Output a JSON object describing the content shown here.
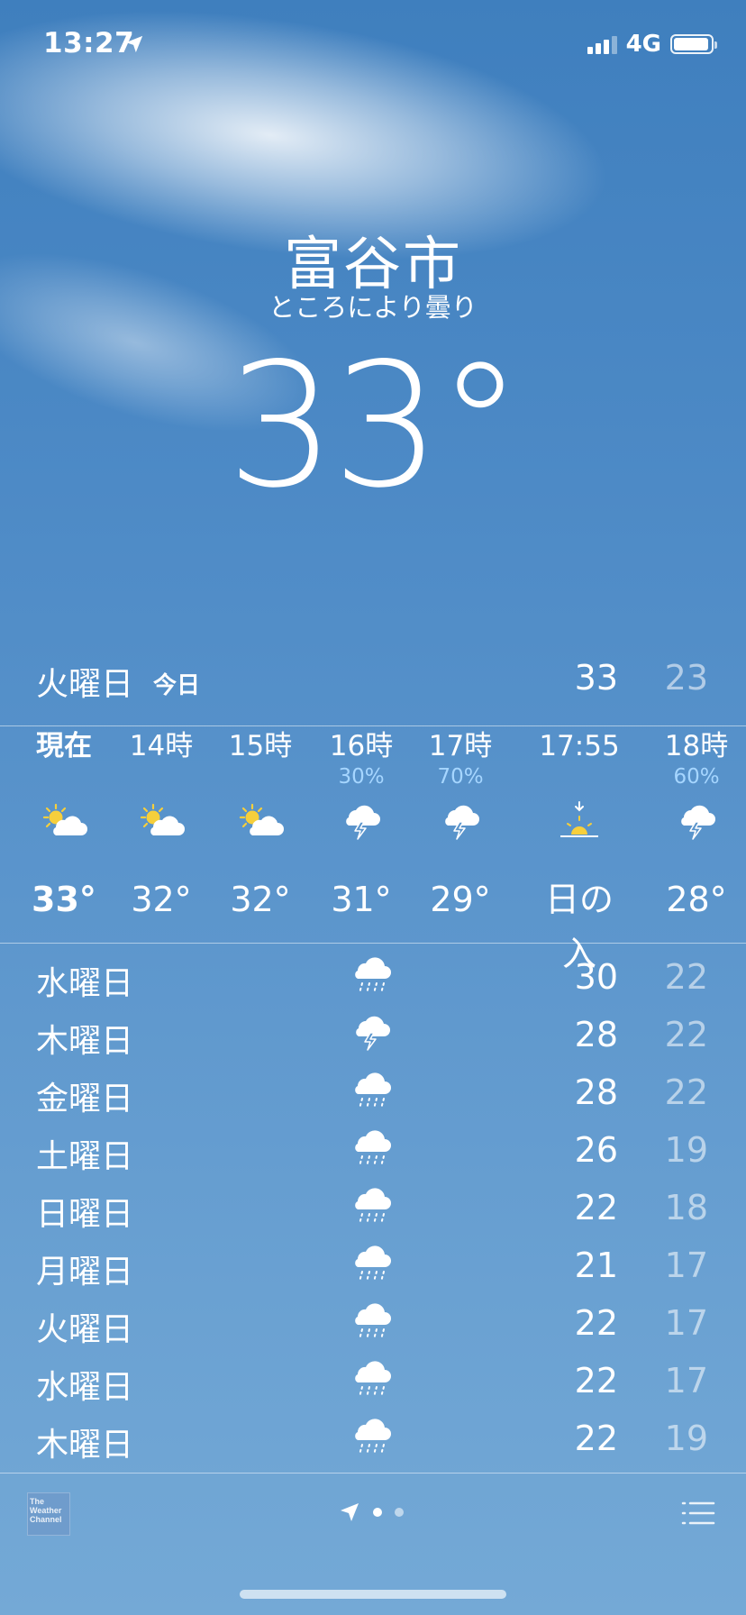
{
  "status_bar": {
    "time": "13:27",
    "network": "4G"
  },
  "location": {
    "city": "富谷市",
    "condition": "ところにより曇り",
    "current_temp": "33°"
  },
  "today": {
    "day": "火曜日",
    "label": "今日",
    "high": "33",
    "low": "23"
  },
  "hourly": [
    {
      "time": "現在",
      "precip": "",
      "icon": "partly-sunny",
      "temp": "33°"
    },
    {
      "time": "14時",
      "precip": "",
      "icon": "partly-sunny",
      "temp": "32°"
    },
    {
      "time": "15時",
      "precip": "",
      "icon": "partly-sunny",
      "temp": "32°"
    },
    {
      "time": "16時",
      "precip": "30%",
      "icon": "thunderstorm",
      "temp": "31°"
    },
    {
      "time": "17時",
      "precip": "70%",
      "icon": "thunderstorm",
      "temp": "29°"
    },
    {
      "time": "17:55",
      "precip": "",
      "icon": "sunset",
      "temp": "日の入"
    },
    {
      "time": "18時",
      "precip": "60%",
      "icon": "thunderstorm",
      "temp": "28°"
    }
  ],
  "daily": [
    {
      "day": "水曜日",
      "icon": "rain",
      "high": "30",
      "low": "22"
    },
    {
      "day": "木曜日",
      "icon": "thunderstorm",
      "high": "28",
      "low": "22"
    },
    {
      "day": "金曜日",
      "icon": "rain",
      "high": "28",
      "low": "22"
    },
    {
      "day": "土曜日",
      "icon": "rain",
      "high": "26",
      "low": "19"
    },
    {
      "day": "日曜日",
      "icon": "rain",
      "high": "22",
      "low": "18"
    },
    {
      "day": "月曜日",
      "icon": "rain",
      "high": "21",
      "low": "17"
    },
    {
      "day": "火曜日",
      "icon": "rain",
      "high": "22",
      "low": "17"
    },
    {
      "day": "水曜日",
      "icon": "rain",
      "high": "22",
      "low": "17"
    },
    {
      "day": "木曜日",
      "icon": "rain",
      "high": "22",
      "low": "19"
    }
  ],
  "toolbar": {
    "logo_text": "The Weather Channel",
    "page_count": 2,
    "active_page": 0
  },
  "colors": {
    "precip_text": "#a6d6ff",
    "sun": "#f6cf3c"
  }
}
